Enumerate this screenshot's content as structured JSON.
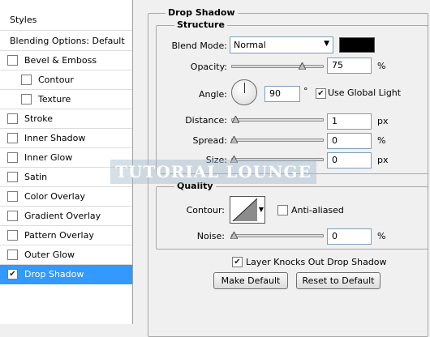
{
  "styles_list": {
    "header": "Styles",
    "blending_options": "Blending Options: Default",
    "items": [
      {
        "label": "Bevel & Emboss",
        "checked": false
      },
      {
        "label": "Contour",
        "checked": false
      },
      {
        "label": "Texture",
        "checked": false
      },
      {
        "label": "Stroke",
        "checked": false
      },
      {
        "label": "Inner Shadow",
        "checked": false
      },
      {
        "label": "Inner Glow",
        "checked": false
      },
      {
        "label": "Satin",
        "checked": false
      },
      {
        "label": "Color Overlay",
        "checked": false
      },
      {
        "label": "Gradient Overlay",
        "checked": false
      },
      {
        "label": "Pattern Overlay",
        "checked": false
      },
      {
        "label": "Outer Glow",
        "checked": false
      },
      {
        "label": "Drop Shadow",
        "checked": true
      }
    ]
  },
  "drop_shadow": {
    "title": "Drop Shadow",
    "structure": {
      "title": "Structure",
      "blend_mode_label": "Blend Mode:",
      "blend_mode_value": "Normal",
      "shadow_color": "#000000",
      "opacity_label": "Opacity:",
      "opacity_value": "75",
      "opacity_unit": "%",
      "opacity_fraction": 0.75,
      "angle_label": "Angle:",
      "angle_value": "90",
      "angle_unit": "°",
      "use_global_light_label": "Use Global Light",
      "use_global_light_checked": true,
      "distance_label": "Distance:",
      "distance_value": "1",
      "distance_unit": "px",
      "spread_label": "Spread:",
      "spread_value": "0",
      "spread_unit": "%",
      "size_label": "Size:",
      "size_value": "0",
      "size_unit": "px"
    },
    "quality": {
      "title": "Quality",
      "contour_label": "Contour:",
      "anti_aliased_label": "Anti-aliased",
      "anti_aliased_checked": false,
      "noise_label": "Noise:",
      "noise_value": "0",
      "noise_unit": "%"
    },
    "layer_knocks_out_label": "Layer Knocks Out Drop Shadow",
    "layer_knocks_out_checked": true,
    "make_default_label": "Make Default",
    "reset_default_label": "Reset to Default"
  },
  "watermark_text": "TUTORIAL LOUNGE",
  "colors": {
    "selection": "#3399ff"
  }
}
